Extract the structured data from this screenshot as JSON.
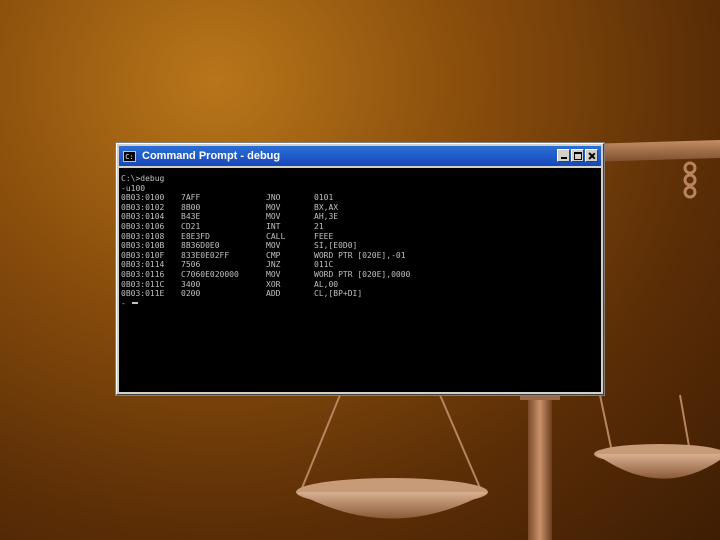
{
  "window": {
    "title": "Command Prompt - debug",
    "buttons": {
      "minimize": "minimize",
      "maximize": "maximize",
      "close": "close"
    }
  },
  "console": {
    "prompt": "C:\\>debug",
    "command": "-u100",
    "rows": [
      {
        "address": "0B03:0100",
        "bytes": "7AFF",
        "op": "JNO",
        "args": "0101"
      },
      {
        "address": "0B03:0102",
        "bytes": "8B00",
        "op": "MOV",
        "args": "BX,AX"
      },
      {
        "address": "0B03:0104",
        "bytes": "B43E",
        "op": "MOV",
        "args": "AH,3E"
      },
      {
        "address": "0B03:0106",
        "bytes": "CD21",
        "op": "INT",
        "args": "21"
      },
      {
        "address": "0B03:0108",
        "bytes": "E8E3FD",
        "op": "CALL",
        "args": "FEEE"
      },
      {
        "address": "0B03:010B",
        "bytes": "8B36D0E0",
        "op": "MOV",
        "args": "SI,[E0D0]"
      },
      {
        "address": "0B03:010F",
        "bytes": "833E0E02FF",
        "op": "CMP",
        "args": "WORD PTR [020E],-01"
      },
      {
        "address": "0B03:0114",
        "bytes": "7506",
        "op": "JNZ",
        "args": "011C"
      },
      {
        "address": "0B03:0116",
        "bytes": "C7060E020000",
        "op": "MOV",
        "args": "WORD PTR [020E],0000"
      },
      {
        "address": "0B03:011C",
        "bytes": "3400",
        "op": "XOR",
        "args": "AL,00"
      },
      {
        "address": "0B03:011E",
        "bytes": "0200",
        "op": "ADD",
        "args": "CL,[BP+DI]"
      }
    ],
    "next_prompt": "-"
  }
}
